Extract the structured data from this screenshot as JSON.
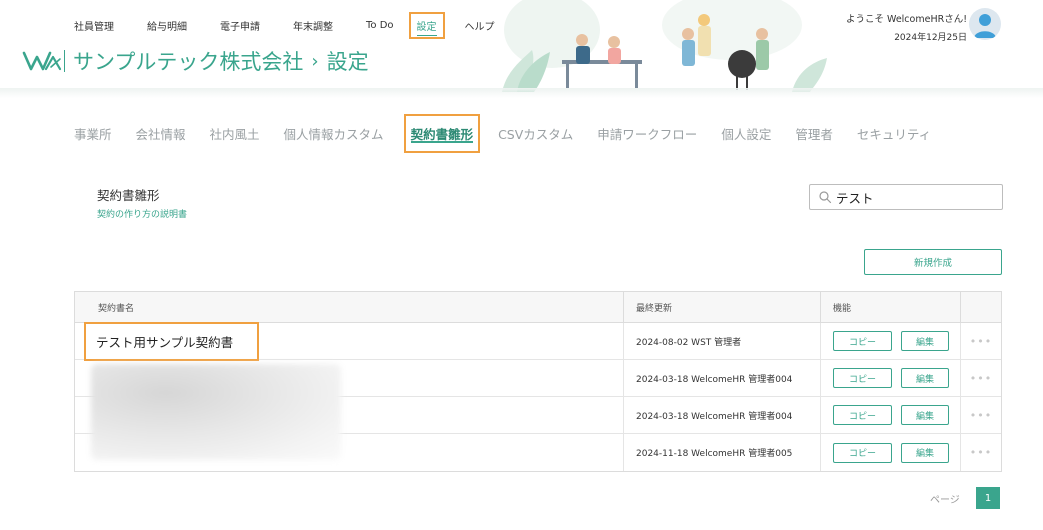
{
  "topnav": {
    "items": [
      {
        "label": "社員管理"
      },
      {
        "label": "給与明細"
      },
      {
        "label": "電子申請"
      },
      {
        "label": "年末調整"
      },
      {
        "label": "To Do"
      },
      {
        "label": "設定"
      },
      {
        "label": "ヘルプ"
      }
    ],
    "active_index": 5
  },
  "brand": {
    "company": "サンプルテック株式会社",
    "arrow": "›",
    "page": "設定"
  },
  "user": {
    "greeting": "ようこそ WelcomeHRさん!",
    "date": "2024年12月25日"
  },
  "tabs": {
    "items": [
      {
        "label": "事業所"
      },
      {
        "label": "会社情報"
      },
      {
        "label": "社内風土"
      },
      {
        "label": "個人情報カスタム"
      },
      {
        "label": "契約書雛形"
      },
      {
        "label": "CSVカスタム"
      },
      {
        "label": "申請ワークフロー"
      },
      {
        "label": "個人設定"
      },
      {
        "label": "管理者"
      },
      {
        "label": "セキュリティ"
      }
    ],
    "active_index": 4
  },
  "section": {
    "title": "契約書雛形",
    "help_link": "契約の作り方の説明書"
  },
  "search": {
    "value": "テスト"
  },
  "new_button": "新規作成",
  "table": {
    "headers": {
      "name": "契約書名",
      "updated": "最終更新",
      "actions": "機能"
    },
    "rows": [
      {
        "name": "テスト用サンプル契約書",
        "updated": "2024-08-02 WST 管理者",
        "copy": "コピー",
        "edit": "編集",
        "more": "•••"
      },
      {
        "name": "",
        "updated": "2024-03-18 WelcomeHR 管理者004",
        "copy": "コピー",
        "edit": "編集",
        "more": "•••"
      },
      {
        "name": "",
        "updated": "2024-03-18 WelcomeHR 管理者004",
        "copy": "コピー",
        "edit": "編集",
        "more": "•••"
      },
      {
        "name": "",
        "updated": "2024-11-18 WelcomeHR 管理者005",
        "copy": "コピー",
        "edit": "編集",
        "more": "•••"
      }
    ]
  },
  "pagination": {
    "label": "ページ",
    "current": "1"
  },
  "colors": {
    "accent": "#3aa58d",
    "highlight": "#f0a040"
  }
}
